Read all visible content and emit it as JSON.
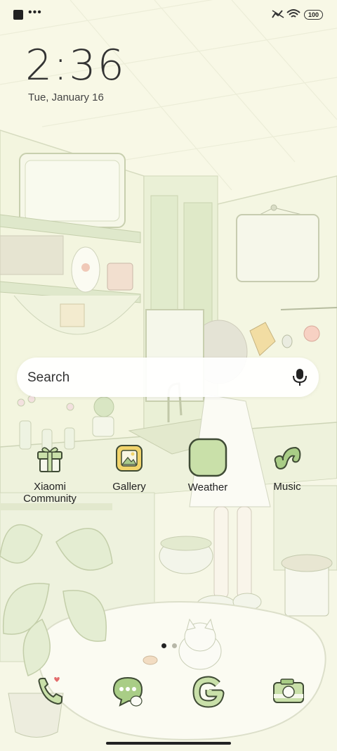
{
  "status_bar": {
    "more_indicator": "•••",
    "battery": "100",
    "icons": [
      "square-notification-icon",
      "signal-icon",
      "wifi-icon",
      "battery-icon"
    ]
  },
  "lockclock": {
    "time": "2:36",
    "date": "Tue, January 16"
  },
  "search": {
    "label": "Search",
    "icon": "mic-icon"
  },
  "apps": [
    {
      "label": "Xiaomi Community",
      "icon": "gift-box-icon"
    },
    {
      "label": "Gallery",
      "icon": "gallery-picture-icon"
    },
    {
      "label": "Weather",
      "icon": "weather-blank-icon"
    },
    {
      "label": "Music",
      "icon": "music-note-icon"
    }
  ],
  "pager": {
    "pages": 2,
    "active_page": 1
  },
  "dock": [
    {
      "icon": "phone-icon"
    },
    {
      "icon": "messages-icon"
    },
    {
      "icon": "google-icon"
    },
    {
      "icon": "camera-icon"
    }
  ],
  "colors": {
    "background": "#f8f8e6",
    "icon_green": "#c9e0a9",
    "icon_outline": "#3f4b35",
    "accent_yellow": "#f1d46b"
  }
}
